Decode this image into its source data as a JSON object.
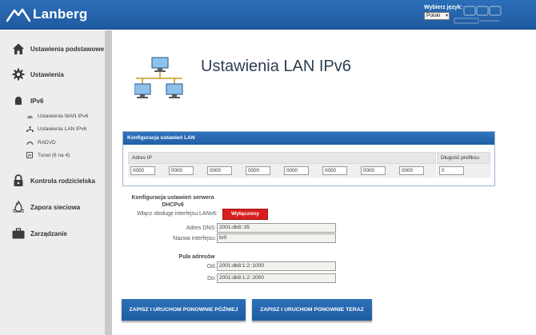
{
  "header": {
    "brand": "Lanberg",
    "language_label": "Wybierz język:",
    "language_value": "Polski",
    "watermark_icon": "purepc-watermark-icon"
  },
  "sidebar": {
    "items": [
      {
        "label": "Ustawienia podstawowe",
        "icon": "home-icon"
      },
      {
        "label": "Ustawienia",
        "icon": "gear-icon"
      },
      {
        "label": "IPv6",
        "icon": "ipv6-icon"
      },
      {
        "label": "Kontrola rodzicielska",
        "icon": "lock-icon"
      },
      {
        "label": "Zapora sieciowa",
        "icon": "firewall-icon"
      },
      {
        "label": "Zarządzanie",
        "icon": "briefcase-icon"
      }
    ],
    "subitems": [
      {
        "label": "Ustawienia WAN IPv6",
        "icon": "wan-icon"
      },
      {
        "label": "Ustawienia LAN IPv6",
        "icon": "lan-icon"
      },
      {
        "label": "RADVD",
        "icon": "radvd-icon"
      },
      {
        "label": "Tunel (6 na 4)",
        "icon": "tunnel-icon"
      }
    ]
  },
  "main": {
    "title": "Ustawienia LAN IPv6",
    "lan_config": {
      "header": "Konfiguracja ustawień LAN",
      "col_ip": "Adres IP",
      "col_prefix": "Długość prefiksu",
      "ip_parts": [
        "0000",
        "0000",
        "0000",
        "0000",
        "0000",
        "0000",
        "0000",
        "0000"
      ],
      "prefix": "0"
    },
    "dhcp": {
      "title": "Konfiguracja ustawień serwera DHCPv6",
      "enable_label": "Włącz obsługę interfejsu LANv6:",
      "enable_value": "Wyłączony",
      "dns_label": "Adres DNS:",
      "dns_value": "2001:db8::35",
      "iface_label": "Nazwa interfejsu:",
      "iface_value": "br0"
    },
    "pool": {
      "title": "Pula adresów",
      "from_label": "Od:",
      "from_value": "2001:db8:1:2::1000",
      "to_label": "Do:",
      "to_value": "2001:db8:1:2::2000"
    },
    "buttons": {
      "save_later": "ZAPISZ I URUCHOM PONOWNIE PÓŹNIEJ",
      "save_now": "ZAPISZ I URUCHOM PONOWNIE TERAZ"
    }
  },
  "colors": {
    "header_blue": "#2563ab",
    "accent_red": "#d81f1f",
    "sidebar_bg": "#ededed"
  }
}
